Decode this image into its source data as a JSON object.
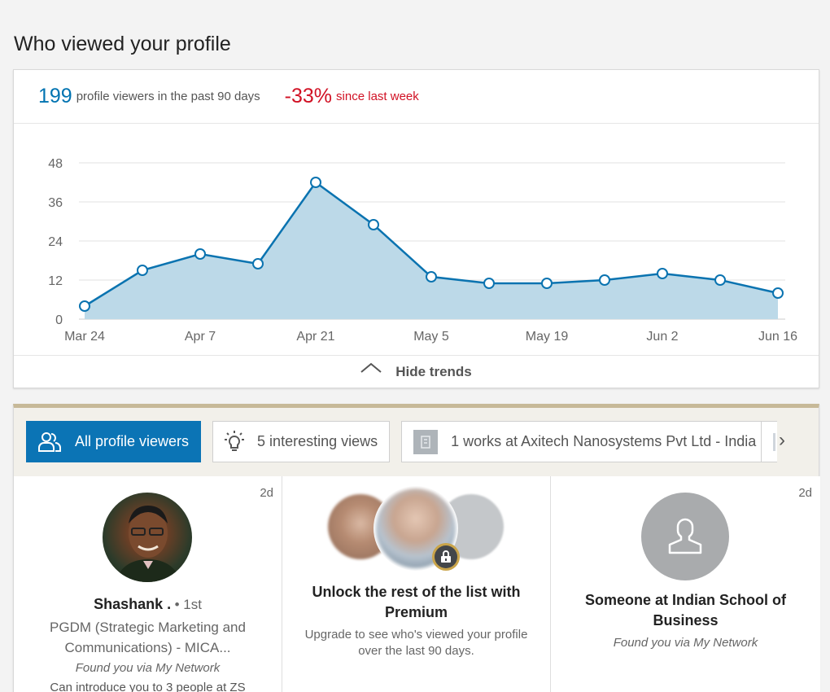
{
  "page": {
    "title": "Who viewed your profile"
  },
  "stats": {
    "viewers_count": "199",
    "viewers_label": "profile viewers in the past 90 days",
    "change_pct": "-33%",
    "change_label": "since last week",
    "accent_color": "#0073b1",
    "negative_color": "#d11124"
  },
  "chart_data": {
    "type": "area",
    "x": [
      "Mar 24",
      "Mar 31",
      "Apr 7",
      "Apr 14",
      "Apr 21",
      "Apr 28",
      "May 5",
      "May 12",
      "May 19",
      "May 26",
      "Jun 2",
      "Jun 9",
      "Jun 16"
    ],
    "values": [
      4,
      15,
      20,
      17,
      42,
      29,
      13,
      11,
      11,
      12,
      14,
      12,
      8
    ],
    "x_tick_labels": [
      "Mar 24",
      "Apr 7",
      "Apr 21",
      "May 5",
      "May 19",
      "Jun 2",
      "Jun 16"
    ],
    "y_ticks": [
      0,
      12,
      24,
      36,
      48
    ],
    "ylim": [
      0,
      48
    ],
    "grid": true,
    "line_color": "#0a73b0",
    "fill_color": "#bcd9e8"
  },
  "trends_toggle": {
    "label": "Hide trends"
  },
  "filters": [
    {
      "label": "All profile viewers",
      "icon": "people-icon",
      "active": true
    },
    {
      "label": "5 interesting views",
      "icon": "lightbulb-icon",
      "active": false
    },
    {
      "label": "1 works at Axitech Nanosystems Pvt Ltd - India",
      "icon": "company-icon",
      "active": false
    }
  ],
  "tiles": [
    {
      "age": "2d",
      "name": "Shashank .",
      "degree": "• 1st",
      "headline_1": "PGDM (Strategic Marketing and",
      "headline_2": "Communications) - MICA...",
      "via": "Found you via My Network",
      "intro": "Can introduce you to 3 people at ZS"
    },
    {
      "title_1": "Unlock the rest of the list with",
      "title_2": "Premium",
      "desc_1": "Upgrade to see who's viewed your profile",
      "desc_2": "over the last 90 days."
    },
    {
      "age": "2d",
      "name_1": "Someone at Indian School of",
      "name_2": "Business",
      "via": "Found you via My Network"
    }
  ]
}
